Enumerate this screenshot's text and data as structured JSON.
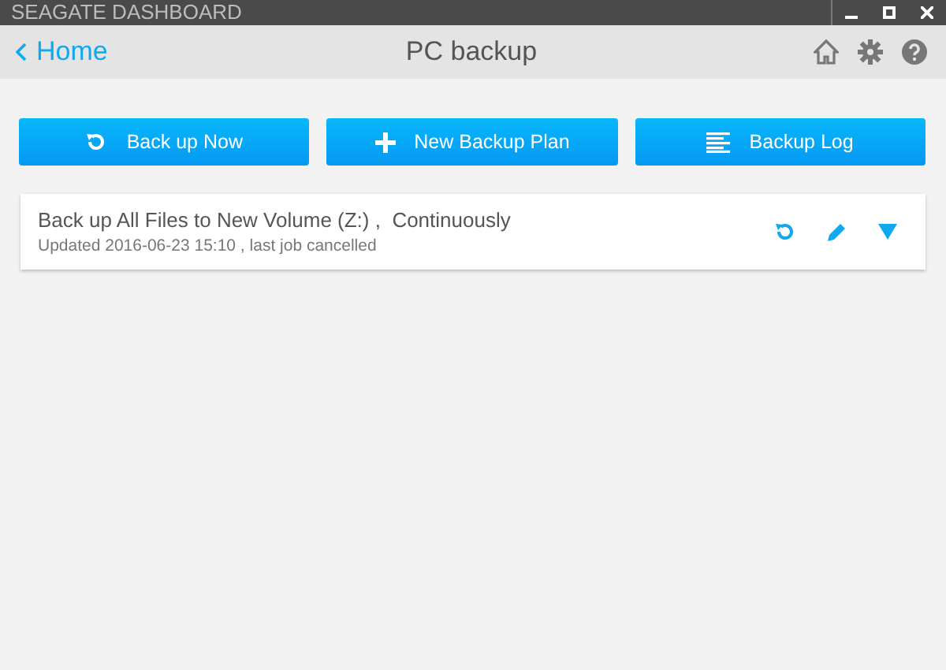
{
  "window": {
    "title": "SEAGATE DASHBOARD"
  },
  "header": {
    "back": "Home",
    "title": "PC backup"
  },
  "actions": [
    {
      "label": "Back up Now",
      "kind": "backup"
    },
    {
      "label": "New Backup Plan",
      "kind": "add"
    },
    {
      "label": "Backup Log",
      "kind": "log"
    }
  ],
  "plans": [
    {
      "title": "Back up All Files to New Volume (Z:) ,  Continuously",
      "status": "Updated 2016-06-23 15:10 , last job cancelled"
    }
  ]
}
